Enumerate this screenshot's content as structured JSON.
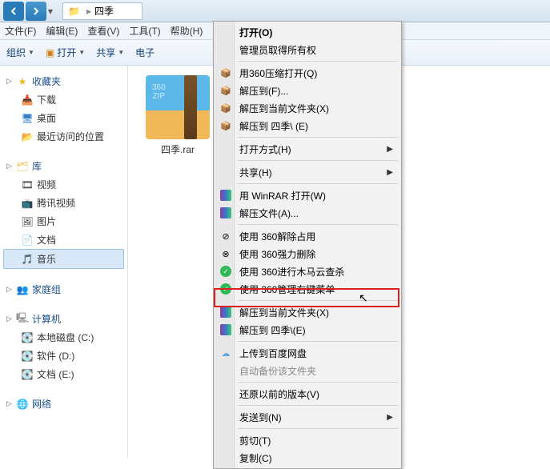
{
  "breadcrumb": {
    "folder": "四季"
  },
  "menubar": {
    "file": "文件(F)",
    "edit": "编辑(E)",
    "view": "查看(V)",
    "tools": "工具(T)",
    "help": "帮助(H)"
  },
  "toolbar": {
    "organize": "组织",
    "open": "打开",
    "share": "共享",
    "email": "电子"
  },
  "sidebar": {
    "favorites": {
      "label": "收藏夹",
      "downloads": "下载",
      "desktop": "桌面",
      "recent": "最近访问的位置"
    },
    "libraries": {
      "label": "库",
      "videos": "视频",
      "tencent": "腾讯视频",
      "pictures": "图片",
      "documents": "文档",
      "music": "音乐"
    },
    "homegroup": {
      "label": "家庭组"
    },
    "computer": {
      "label": "计算机",
      "diskC": "本地磁盘 (C:)",
      "diskD": "软件 (D:)",
      "diskE": "文档 (E:)"
    },
    "network": {
      "label": "网络"
    }
  },
  "file": {
    "name": "四季.rar"
  },
  "context_menu": {
    "open": "打开(O)",
    "admin": "管理员取得所有权",
    "open360": "用360压缩打开(Q)",
    "extractTo": "解压到(F)...",
    "extractHere": "解压到当前文件夹(X)",
    "extractFolder": "解压到 四季\\ (E)",
    "openWith": "打开方式(H)",
    "share": "共享(H)",
    "openWinrar": "用 WinRAR 打开(W)",
    "extractFiles": "解压文件(A)...",
    "use360Unlock": "使用 360解除占用",
    "use360Force": "使用 360强力删除",
    "use360Trojan": "使用 360进行木马云查杀",
    "use360Menu": "使用 360管理右键菜单",
    "extractHere2": "解压到当前文件夹(X)",
    "extractFolder2": "解压到 四季\\(E)",
    "uploadBaidu": "上传到百度网盘",
    "autoBackup": "自动备份该文件夹",
    "restore": "还原以前的版本(V)",
    "sendTo": "发送到(N)",
    "cut": "剪切(T)",
    "copy": "复制(C)"
  }
}
